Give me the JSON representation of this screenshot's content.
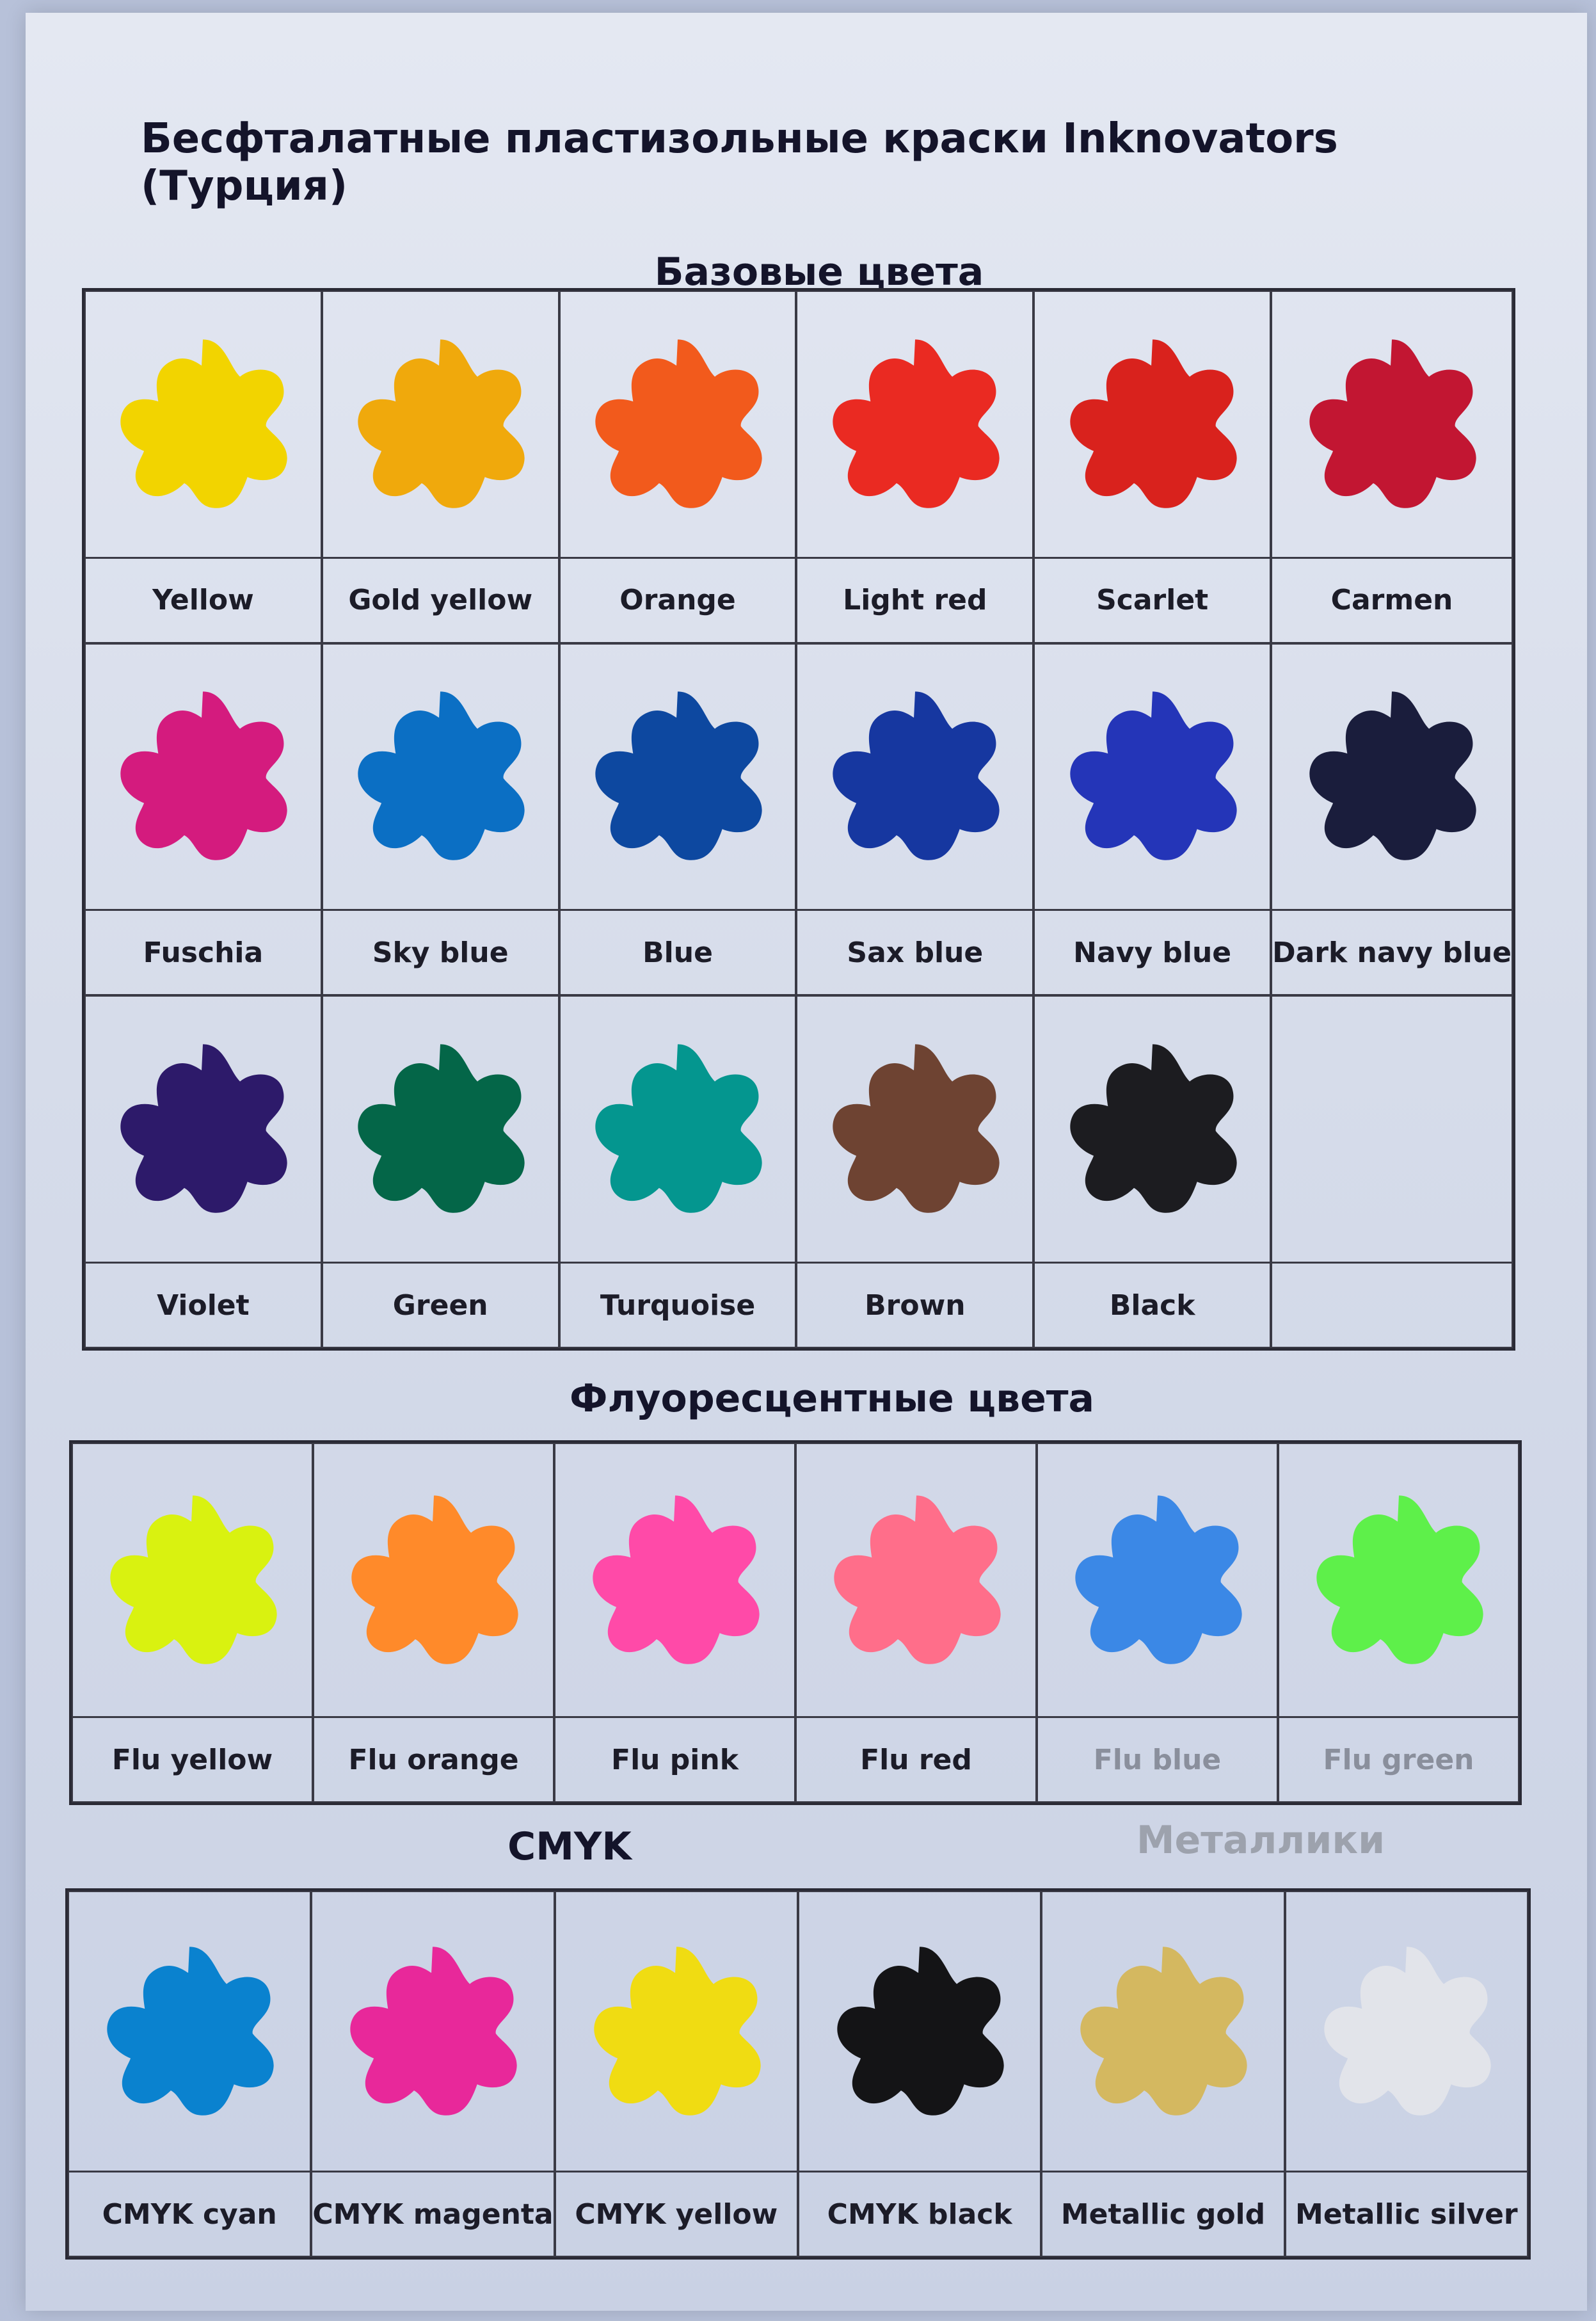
{
  "title": "Бесфталатные пластизольные краски Inknovators (Турция)",
  "sections": {
    "base": {
      "title": "Базовые цвета",
      "items": [
        {
          "label": "Yellow",
          "color": "#f2d400"
        },
        {
          "label": "Gold yellow",
          "color": "#f0a90c"
        },
        {
          "label": "Orange",
          "color": "#f25a1c"
        },
        {
          "label": "Light red",
          "color": "#ea2a22"
        },
        {
          "label": "Scarlet",
          "color": "#d9221d"
        },
        {
          "label": "Carmen",
          "color": "#c21632"
        },
        {
          "label": "Fuschia",
          "color": "#d41b7e"
        },
        {
          "label": "Sky blue",
          "color": "#0b6fc4"
        },
        {
          "label": "Blue",
          "color": "#0d48a0"
        },
        {
          "label": "Sax blue",
          "color": "#1637a0"
        },
        {
          "label": "Navy blue",
          "color": "#2435b8"
        },
        {
          "label": "Dark navy blue",
          "color": "#1a1d3c"
        },
        {
          "label": "Violet",
          "color": "#2d1a6a"
        },
        {
          "label": "Green",
          "color": "#046648"
        },
        {
          "label": "Turquoise",
          "color": "#04968f"
        },
        {
          "label": "Brown",
          "color": "#6e4332"
        },
        {
          "label": "Black",
          "color": "#1c1c20"
        },
        {
          "label": "",
          "color": ""
        }
      ]
    },
    "fluo": {
      "title": "Флуоресцентные цвета",
      "items": [
        {
          "label": "Flu yellow",
          "color": "#d9f210"
        },
        {
          "label": "Flu orange",
          "color": "#ff8a2a"
        },
        {
          "label": "Flu pink",
          "color": "#ff4aa8"
        },
        {
          "label": "Flu red",
          "color": "#ff6e8a"
        },
        {
          "label": "Flu blue",
          "color": "#3b88e6"
        },
        {
          "label": "Flu green",
          "color": "#5ef04a"
        }
      ]
    },
    "cmyk": {
      "title": "CMYK",
      "metallic_title": "Металлики",
      "items": [
        {
          "label": "CMYK cyan",
          "color": "#0a82cf"
        },
        {
          "label": "CMYK magenta",
          "color": "#e8289a"
        },
        {
          "label": "CMYK yellow",
          "color": "#f0dc12"
        },
        {
          "label": "CMYK black",
          "color": "#141416"
        },
        {
          "label": "Metallic gold",
          "color": "#d4b860"
        },
        {
          "label": "Metallic silver",
          "color": "#e2e4ea"
        }
      ]
    }
  }
}
